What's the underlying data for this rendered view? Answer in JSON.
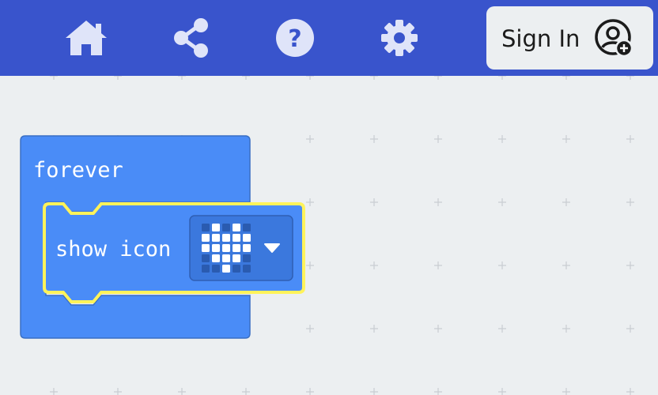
{
  "header": {
    "nav_icons": [
      "home-icon",
      "share-icon",
      "help-icon",
      "settings-icon"
    ],
    "signin_label": "Sign In",
    "signin_icon": "user-add-icon",
    "colors": {
      "bar": "#3954cc",
      "icon": "#dfe4f9",
      "signin_bg": "#eceff1"
    }
  },
  "workspace": {
    "blocks": {
      "forever_label": "forever",
      "show_icon_label": "show icon",
      "icon_value": "heart",
      "dropdown_icon": "caret-down-icon"
    },
    "colors": {
      "block": "#4a8cf7",
      "block_border": "#3a6fc4",
      "highlight": "#fff35a",
      "grid_mark": "#c9cdd2"
    }
  }
}
